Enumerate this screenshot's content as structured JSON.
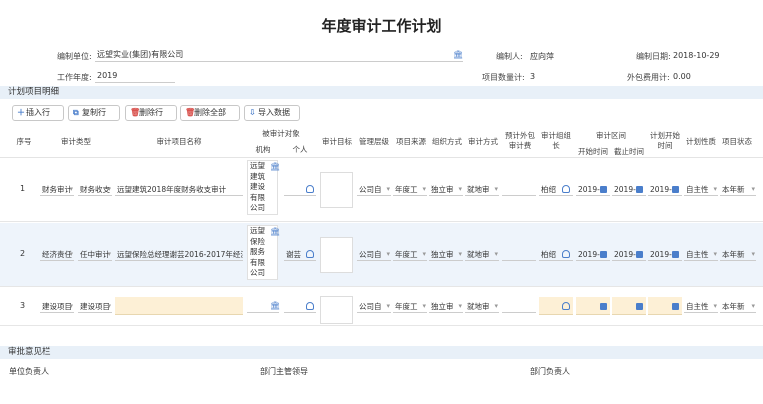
{
  "title": "年度审计工作计划",
  "form": {
    "unit_label": "编制单位:",
    "unit_value": "远望实业(集团)有限公司",
    "person_label": "编制人:",
    "person_value": "应向萍",
    "date_label": "编制日期:",
    "date_value": "2018-10-29",
    "year_label": "工作年度:",
    "year_value": "2019",
    "count_label": "项目数量计:",
    "count_value": "3",
    "cost_label": "外包费用计:",
    "cost_value": "0.00"
  },
  "detail_section": "计划项目明细",
  "toolbar": {
    "insert": "插入行",
    "copy": "复制行",
    "delete": "删除行",
    "delete_all": "删除全部",
    "import": "导入数据"
  },
  "headers": {
    "seq": "序号",
    "type": "审计类型",
    "name": "审计项目名称",
    "target": "被审计对象",
    "target_org": "机构",
    "target_person": "个人",
    "goal": "审计目标",
    "level": "管理层级",
    "source": "项目来源",
    "org_mode": "组织方式",
    "audit_mode": "审计方式",
    "cost_1": "预计外包",
    "cost_2": "审计费",
    "leader_1": "审计组组",
    "leader_2": "长",
    "range": "审计区间",
    "start": "开始时间",
    "end": "截止时间",
    "plan_1": "计划开始",
    "plan_2": "时间",
    "nature": "计划性质",
    "status": "项目状态"
  },
  "rows": [
    {
      "seq": "1",
      "type_a": "财务审计",
      "type_b": "财务收支",
      "name": "远望建筑2018年度财务收支审计",
      "org": [
        "远望",
        "建筑",
        "建设",
        "有限",
        "公司"
      ],
      "person": "",
      "level": "公司自",
      "source": "年度工",
      "org_mode": "独立审",
      "audit_mode": "就地审",
      "leader": "柏绍",
      "start": "2019-",
      "end": "2019-",
      "plan": "2019-",
      "nature": "自主性",
      "status": "本年新"
    },
    {
      "seq": "2",
      "type_a": "经济责任",
      "type_b": "任中审计",
      "name": "远望保险总经理谢芸2016-2017年经济",
      "org": [
        "远望",
        "保险",
        "服务",
        "有限",
        "公司"
      ],
      "person": "谢芸",
      "level": "公司自",
      "source": "年度工",
      "org_mode": "独立审",
      "audit_mode": "就地审",
      "leader": "柏绍",
      "start": "2019-",
      "end": "2019-",
      "plan": "2019-",
      "nature": "自主性",
      "status": "本年新"
    },
    {
      "seq": "3",
      "type_a": "建设项目",
      "type_b": "建设项目",
      "name": "",
      "org": [],
      "person": "",
      "level": "公司自",
      "source": "年度工",
      "org_mode": "独立审",
      "audit_mode": "就地审",
      "leader": "",
      "start": "",
      "end": "",
      "plan": "",
      "nature": "自主性",
      "status": "本年新"
    }
  ],
  "approval": {
    "section": "审批意见栏",
    "unit_head": "单位负责人",
    "dept_leader": "部门主管领导",
    "dept_head": "部门负责人"
  },
  "colors": {
    "accent": "#4a7ecb",
    "section_bg": "#e8f0f8",
    "row_highlight": "#eef4fb",
    "required": "#fdf0d6"
  }
}
